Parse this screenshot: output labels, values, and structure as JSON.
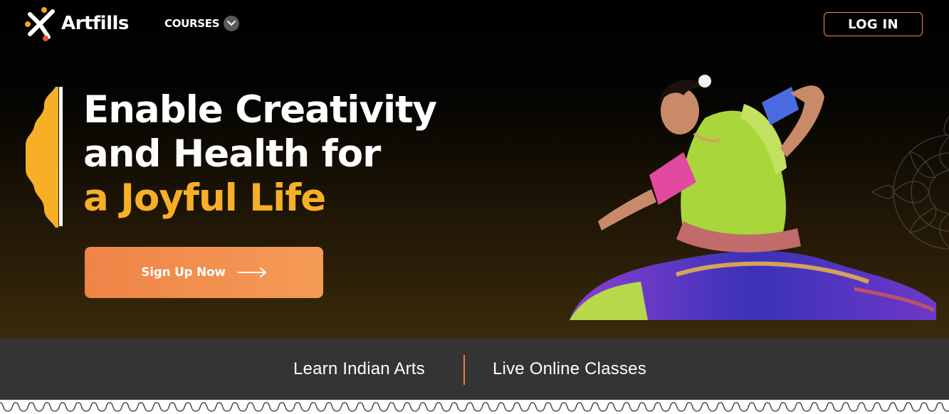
{
  "header": {
    "brand": "Artfills",
    "nav_courses": "COURSES",
    "login": "LOG IN"
  },
  "hero": {
    "headline_line1": "Enable Creativity",
    "headline_line2": "and Health for",
    "headline_line3": "a Joyful Life",
    "cta_label": "Sign Up Now"
  },
  "tagline": {
    "left": "Learn Indian Arts",
    "right": "Live Online Classes"
  },
  "colors": {
    "accent_orange": "#ef8447",
    "accent_yellow": "#f7b026",
    "bar_gray": "#343434"
  },
  "icons": [
    "artfills-logo-icon",
    "chevron-down-icon",
    "arrow-right-icon",
    "mandala-icon"
  ]
}
